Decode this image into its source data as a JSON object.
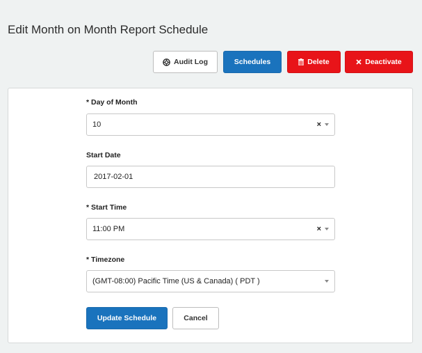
{
  "page": {
    "title": "Edit Month on Month Report Schedule"
  },
  "toolbar": {
    "audit_log_label": "Audit Log",
    "schedules_label": "Schedules",
    "delete_label": "Delete",
    "deactivate_label": "Deactivate",
    "icons": {
      "audit_log": "lifebuoy-icon",
      "delete": "trash-icon",
      "deactivate": "close-icon"
    }
  },
  "form": {
    "day_of_month": {
      "label": "* Day of Month",
      "value": "10"
    },
    "start_date": {
      "label": "Start Date",
      "value": "2017-02-01"
    },
    "start_time": {
      "label": "* Start Time",
      "value": "11:00 PM"
    },
    "timezone": {
      "label": "* Timezone",
      "value": "(GMT-08:00) Pacific Time (US & Canada) ( PDT )"
    },
    "update_label": "Update Schedule",
    "cancel_label": "Cancel"
  },
  "colors": {
    "primary": "#1a73bd",
    "danger": "#e81419",
    "background": "#eff2f2"
  }
}
